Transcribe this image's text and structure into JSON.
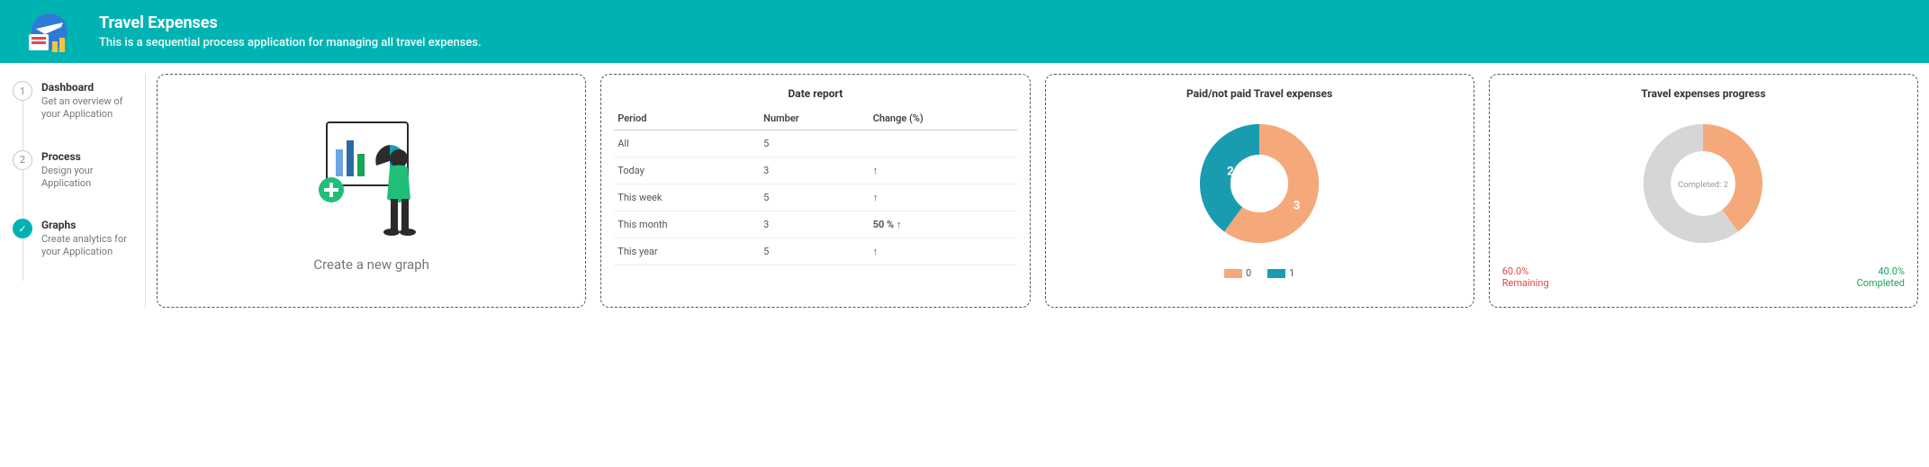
{
  "header": {
    "title": "Travel Expenses",
    "subtitle": "This is a sequential process application for managing all travel expenses."
  },
  "sidebar": {
    "steps": [
      {
        "n": "1",
        "title": "Dashboard",
        "desc": "Get an overview of your Application"
      },
      {
        "n": "2",
        "title": "Process",
        "desc": "Design your Application"
      },
      {
        "n": "✓",
        "title": "Graphs",
        "desc": "Create analytics for your Application"
      }
    ]
  },
  "newGraph": {
    "label": "Create a new graph"
  },
  "dateReport": {
    "title": "Date report",
    "cols": [
      "Period",
      "Number",
      "Change (%)"
    ],
    "rows": [
      {
        "period": "All",
        "number": "5",
        "change": ""
      },
      {
        "period": "Today",
        "number": "3",
        "change": "↑"
      },
      {
        "period": "This week",
        "number": "5",
        "change": "↑"
      },
      {
        "period": "This month",
        "number": "3",
        "change": "50 % ↑"
      },
      {
        "period": "This year",
        "number": "5",
        "change": "↑"
      }
    ]
  },
  "paidChart": {
    "title": "Paid/not paid Travel expenses",
    "legend": [
      {
        "label": "0",
        "color": "#f5a97a"
      },
      {
        "label": "1",
        "color": "#1a9cb0"
      }
    ]
  },
  "progressChart": {
    "title": "Travel expenses progress",
    "centerLabel": "Completed: 2",
    "remaining": {
      "pct": "60.0%",
      "label": "Remaining"
    },
    "completed": {
      "pct": "40.0%",
      "label": "Completed"
    }
  },
  "chart_data": [
    {
      "type": "table",
      "title": "Date report",
      "columns": [
        "Period",
        "Number",
        "Change (%)"
      ],
      "rows": [
        [
          "All",
          5,
          null
        ],
        [
          "Today",
          3,
          null
        ],
        [
          "This week",
          5,
          null
        ],
        [
          "This month",
          3,
          50
        ],
        [
          "This year",
          5,
          null
        ]
      ]
    },
    {
      "type": "pie",
      "title": "Paid/not paid Travel expenses",
      "series": [
        {
          "name": "0",
          "value": 3,
          "color": "#f5a97a"
        },
        {
          "name": "1",
          "value": 2,
          "color": "#1a9cb0"
        }
      ],
      "donut": true
    },
    {
      "type": "pie",
      "title": "Travel expenses progress",
      "series": [
        {
          "name": "Completed",
          "value": 40.0,
          "color": "#f5a97a"
        },
        {
          "name": "Remaining",
          "value": 60.0,
          "color": "#d6d6d6"
        }
      ],
      "donut": true,
      "center_label": "Completed: 2"
    }
  ]
}
